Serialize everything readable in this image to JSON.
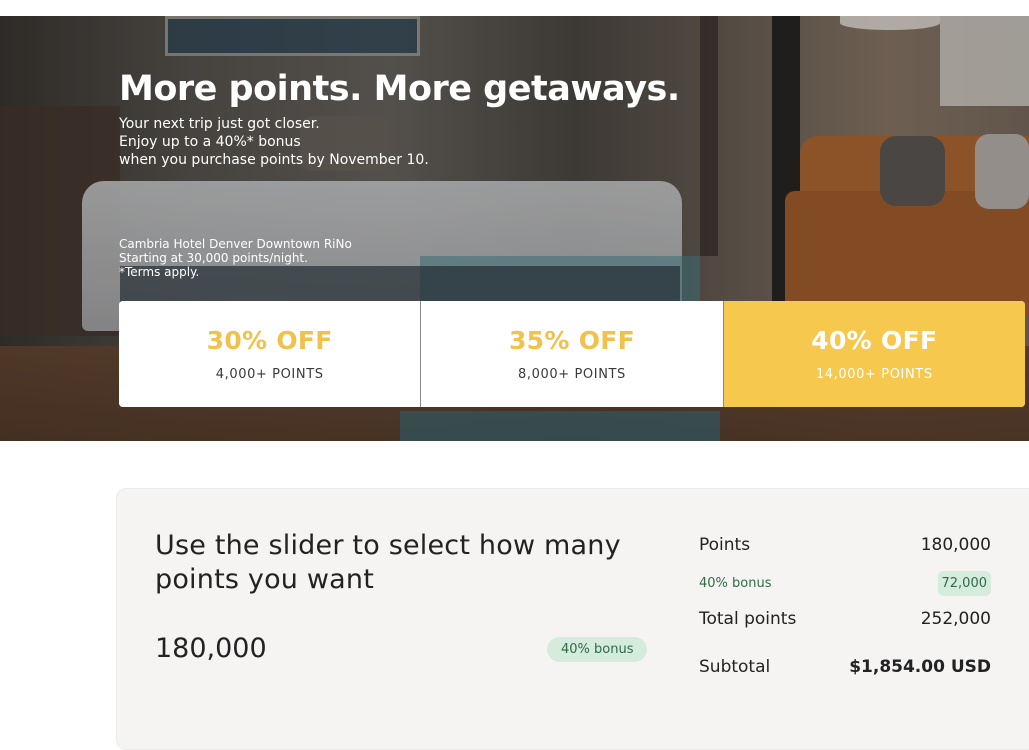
{
  "hero": {
    "title": "More points. More getaways.",
    "subtitle_lines": [
      "Your next trip just got closer.",
      "Enjoy up to a 40%* bonus",
      "when you purchase points by November 10."
    ],
    "caption_lines": [
      "Cambria Hotel Denver Downtown RiNo",
      "Starting at 30,000 points/night.",
      "*Terms apply."
    ]
  },
  "offers": [
    {
      "discount": "30% OFF",
      "points": "4,000+ POINTS",
      "selected": false
    },
    {
      "discount": "35% OFF",
      "points": "8,000+ POINTS",
      "selected": false
    },
    {
      "discount": "40% OFF",
      "points": "14,000+ POINTS",
      "selected": true
    }
  ],
  "calculator": {
    "title": "Use the slider to select how many points you want",
    "selected_points": "180,000",
    "bonus_pill": "40% bonus"
  },
  "summary": {
    "points_label": "Points",
    "points_value": "180,000",
    "bonus_label": "40% bonus",
    "bonus_value": "72,000",
    "total_label": "Total points",
    "total_value": "252,000",
    "subtotal_label": "Subtotal",
    "subtotal_value": "$1,854.00 USD"
  },
  "colors": {
    "accent_yellow": "#f6c84e",
    "offer_text_yellow": "#f2c14a",
    "bonus_green_bg": "#d5ecdc",
    "bonus_green_text": "#2f6b45"
  }
}
